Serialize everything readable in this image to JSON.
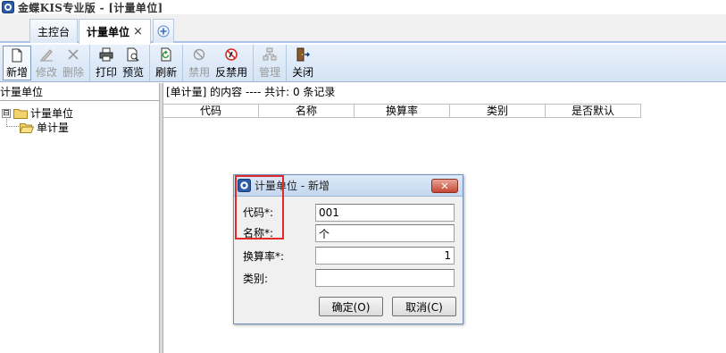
{
  "window": {
    "title": "金蝶KIS专业版 - [计量单位]"
  },
  "tabs": {
    "main_label": "主控台",
    "active_label": "计量单位",
    "close_glyph": "×"
  },
  "toolbar": {
    "new": "新增",
    "edit": "修改",
    "delete": "删除",
    "print": "打印",
    "preview": "预览",
    "refresh": "刷新",
    "disable": "禁用",
    "enable": "反禁用",
    "manage": "管理",
    "close": "关闭"
  },
  "left_panel": {
    "header": "计量单位",
    "tree": {
      "root_label": "计量单位",
      "expander": "⊟",
      "children": [
        "单计量"
      ]
    }
  },
  "right_panel": {
    "header": "[单计量] 的内容 ---- 共计: 0 条记录",
    "columns": [
      "代码",
      "名称",
      "换算率",
      "类别",
      "是否默认"
    ]
  },
  "dialog": {
    "title": "计量单位 - 新增",
    "close_glyph": "✕",
    "fields": {
      "code_label": "代码*:",
      "code_value": "001",
      "name_label": "名称*:",
      "name_value": "个",
      "rate_label": "换算率*:",
      "rate_value": "1",
      "category_label": "类别:",
      "category_value": ""
    },
    "ok_label": "确定(O)",
    "cancel_label": "取消(C)"
  },
  "colors": {
    "toolbar_bg": "#d4e3f5",
    "highlight": "#e02b2b",
    "dialog_close": "#c54733"
  }
}
